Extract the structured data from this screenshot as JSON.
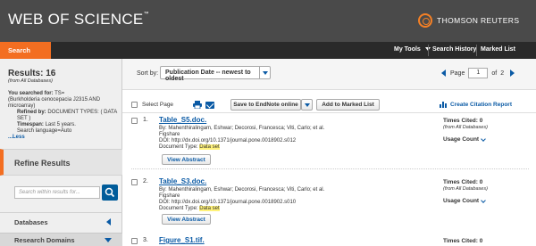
{
  "header": {
    "logo": "WEB OF SCIENCE",
    "logo_tm": "™",
    "brand": "THOMSON REUTERS",
    "brand_tm": "®"
  },
  "tabs": {
    "search": "Search",
    "my_tools": "My Tools",
    "search_history": "Search History",
    "marked_list": "Marked List"
  },
  "sidebar": {
    "results_title": "Results: 16",
    "from_db": "(from All Databases)",
    "you_searched_label": "You searched for:",
    "query_prefix": "TS=",
    "query_text": "(Burkholderia cenocepacia J2315 AND microarray)",
    "refined_label": "Refined by:",
    "refined_text": "DOCUMENT TYPES: ( DATA SET )",
    "timespan_label": "Timespan:",
    "timespan_text": "Last 5 years.",
    "search_language": "Search language=Auto",
    "less_link": "...Less",
    "refine_title": "Refine Results",
    "refine_placeholder": "Search within results for...",
    "databases_label": "Databases",
    "research_domains_label": "Research Domains"
  },
  "sort_bar": {
    "sort_label": "Sort by:",
    "sort_value": "Publication Date -- newest to oldest",
    "page_label": "Page",
    "page_value": "1",
    "of_label": "of",
    "total_pages": "2"
  },
  "toolbar": {
    "select_page": "Select Page",
    "save_endnote": "Save to EndNote online",
    "add_marked": "Add to Marked List",
    "citation_report": "Create Citation Report"
  },
  "records": [
    {
      "num": "1.",
      "title": "Table_S5.doc.",
      "authors": "By: Mahenthiralingam, Eshwar; Decorosi, Francesca; Viti, Carlo; et al.",
      "source": "Figshare",
      "doi_label": "DOI:",
      "doi": "http://dx.doi.org/10.1371/journal.pone.0018902.s012",
      "doctype_label": "Document Type:",
      "doctype": "Data set",
      "view_abstract": "View Abstract",
      "times_cited": "Times Cited: 0",
      "times_cited_sub": "(from All Databases)",
      "usage_count": "Usage Count"
    },
    {
      "num": "2.",
      "title": "Table_S3.doc.",
      "authors": "By: Mahenthiralingam, Eshwar; Decorosi, Francesca; Viti, Carlo; et al.",
      "source": "Figshare",
      "doi_label": "DOI:",
      "doi": "http://dx.doi.org/10.1371/journal.pone.0018902.s010",
      "doctype_label": "Document Type:",
      "doctype": "Data set",
      "view_abstract": "View Abstract",
      "times_cited": "Times Cited: 0",
      "times_cited_sub": "(from All Databases)",
      "usage_count": "Usage Count"
    },
    {
      "num": "3.",
      "title": "Figure_S1.tif.",
      "times_cited": "Times Cited: 0"
    }
  ],
  "colors": {
    "header_bg": "#4a4a4a",
    "tabbar_bg": "#2a2a2a",
    "accent_orange": "#f36e21",
    "link_blue": "#0a5aa5",
    "highlight": "#fff27a"
  }
}
